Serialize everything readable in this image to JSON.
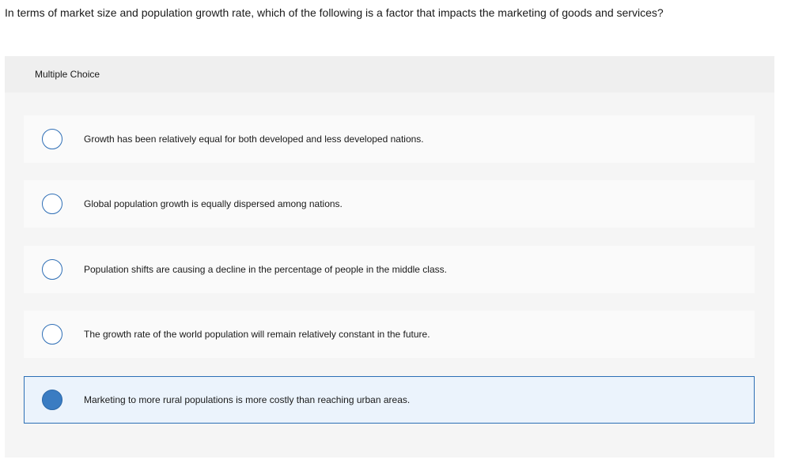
{
  "question": {
    "text": "In terms of market size and population growth rate, which of the following is a factor that impacts the marketing of goods and services?"
  },
  "panel": {
    "header_label": "Multiple Choice"
  },
  "choices": [
    {
      "label": "Growth has been relatively equal for both developed and less developed nations.",
      "selected": false
    },
    {
      "label": "Global population growth is equally dispersed among nations.",
      "selected": false
    },
    {
      "label": "Population shifts are causing a decline in the percentage of people in the middle class.",
      "selected": false
    },
    {
      "label": "The growth rate of the world population will remain relatively constant in the future.",
      "selected": false
    },
    {
      "label": "Marketing to more rural populations is more costly than reaching urban areas.",
      "selected": true
    }
  ],
  "colors": {
    "accent": "#2f6fb6",
    "selected_fill": "#3a7cc2",
    "selected_background": "#ebf3fc"
  }
}
